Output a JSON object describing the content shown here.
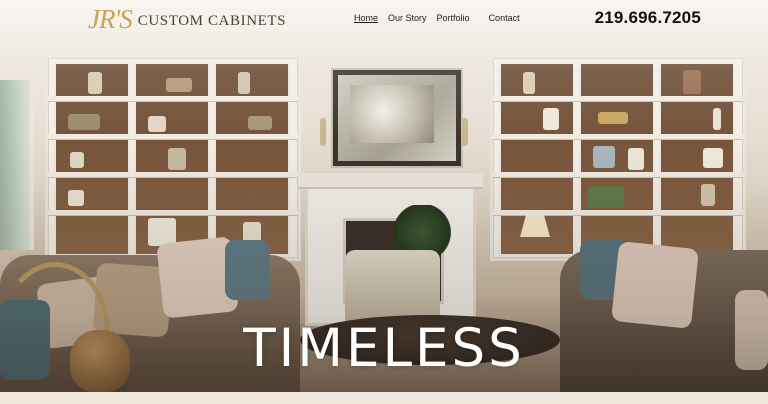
{
  "header": {
    "logo_mark": "JR'S",
    "logo_text": "CUSTOM CABINETS",
    "nav": [
      {
        "label": "Home",
        "active": true
      },
      {
        "label": "Our Story",
        "active": false
      },
      {
        "label": "Portfolio",
        "active": false
      },
      {
        "label": "Contact",
        "active": false
      }
    ],
    "phone": "219.696.7205"
  },
  "hero": {
    "title": "TIMELESS",
    "image_icon": "living-room-photo"
  },
  "colors": {
    "logo_gold": "#c9a257",
    "text_dark": "#111111",
    "title_white": "#ffffff"
  }
}
